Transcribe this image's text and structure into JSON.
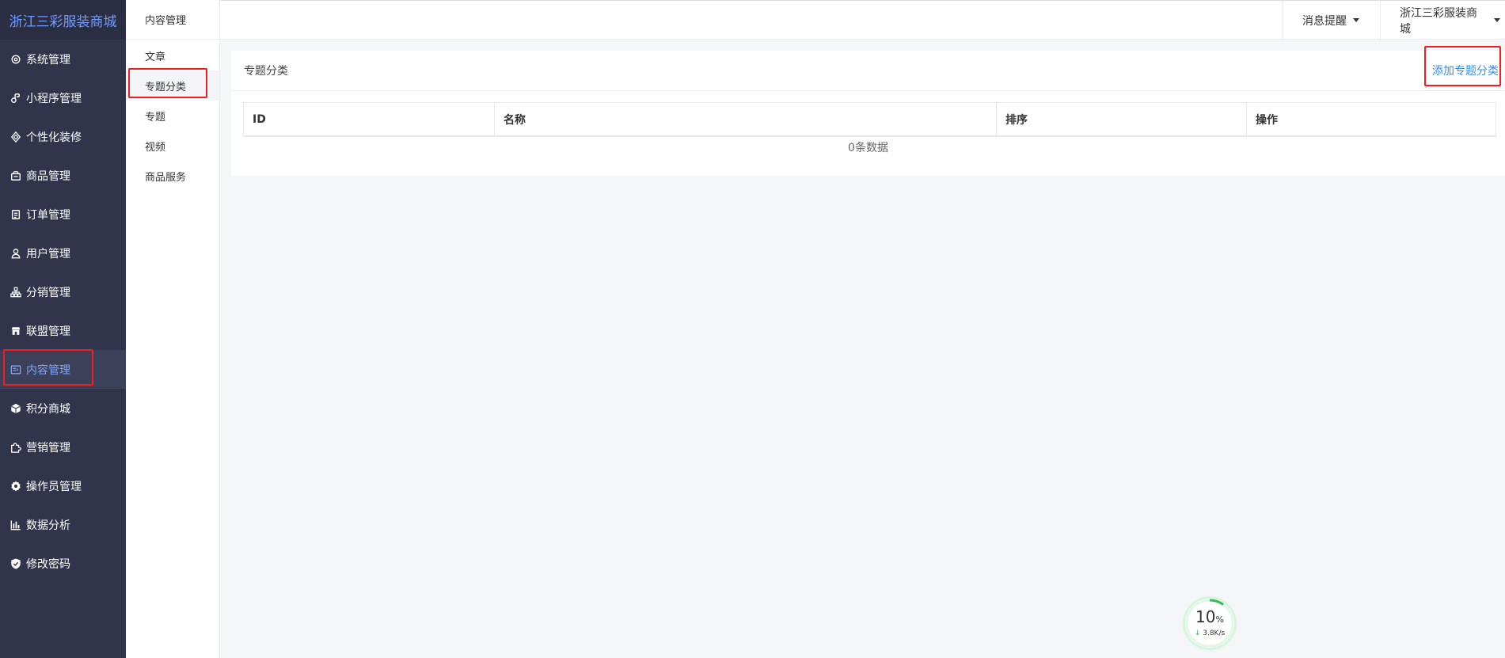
{
  "brand": "浙江三彩服装商城",
  "sidebar": {
    "items": [
      {
        "label": "系统管理",
        "icon": "gear-outline-icon"
      },
      {
        "label": "小程序管理",
        "icon": "link-icon"
      },
      {
        "label": "个性化装修",
        "icon": "diamond-icon"
      },
      {
        "label": "商品管理",
        "icon": "bag-icon"
      },
      {
        "label": "订单管理",
        "icon": "clipboard-icon"
      },
      {
        "label": "用户管理",
        "icon": "user-icon"
      },
      {
        "label": "分销管理",
        "icon": "hierarchy-icon"
      },
      {
        "label": "联盟管理",
        "icon": "store-icon"
      },
      {
        "label": "内容管理",
        "icon": "content-icon",
        "active": true
      },
      {
        "label": "积分商城",
        "icon": "cube-icon"
      },
      {
        "label": "营销管理",
        "icon": "puzzle-icon"
      },
      {
        "label": "操作员管理",
        "icon": "gear-solid-icon"
      },
      {
        "label": "数据分析",
        "icon": "bar-chart-icon"
      },
      {
        "label": "修改密码",
        "icon": "shield-icon"
      }
    ],
    "active_color": "#7ea6ff",
    "background": "#31344a"
  },
  "subnav": {
    "title": "内容管理",
    "items": [
      {
        "label": "文章"
      },
      {
        "label": "专题分类",
        "active": true
      },
      {
        "label": "专题"
      },
      {
        "label": "视频"
      },
      {
        "label": "商品服务"
      }
    ]
  },
  "header": {
    "notifications": "消息提醒",
    "account": "浙江三彩服装商城"
  },
  "card": {
    "title": "专题分类",
    "add_button": "添加专题分类",
    "columns": [
      "ID",
      "名称",
      "排序",
      "操作"
    ],
    "empty_text": "0条数据"
  },
  "speed_widget": {
    "percent": "10",
    "percent_unit": "%",
    "rate": "3.8K/s",
    "ring_color": "#2ebd59"
  }
}
